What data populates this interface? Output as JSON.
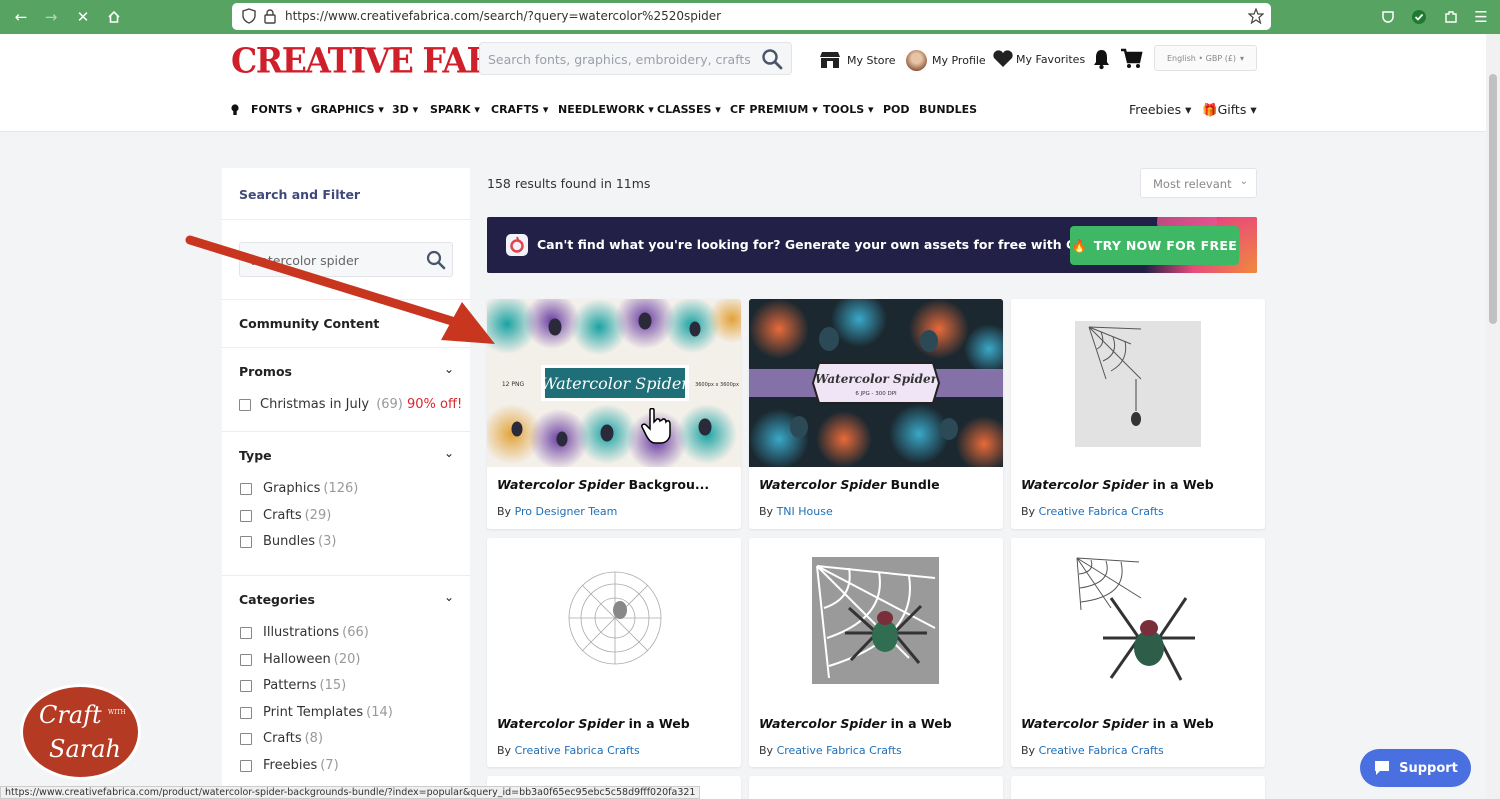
{
  "browser": {
    "url": "https://www.creativefabrica.com/search/?query=watercolor%2520spider",
    "status_url": "https://www.creativefabrica.com/product/watercolor-spider-backgrounds-bundle/?index=popular&query_id=bb3a0f65ec95ebc5c58d9fff020fa321"
  },
  "header": {
    "logo": "CREATIVE FABRICA",
    "search_placeholder": "Search fonts, graphics, embroidery, crafts",
    "my_store": "My Store",
    "my_profile": "My Profile",
    "my_favorites": "My Favorites",
    "language": "English • GBP (£)",
    "nav": [
      "FONTS",
      "GRAPHICS",
      "3D",
      "SPARK",
      "CRAFTS",
      "NEEDLEWORK",
      "CLASSES",
      "CF PREMIUM",
      "TOOLS",
      "POD",
      "BUNDLES"
    ],
    "freebies": "Freebies",
    "gifts": "Gifts"
  },
  "sidebar": {
    "title": "Search and Filter",
    "search_value": "watercolor spider",
    "community": "Community Content",
    "promos": {
      "title": "Promos",
      "item": "Christmas in July",
      "count": "(69)",
      "promo": "90% off!"
    },
    "type": {
      "title": "Type",
      "items": [
        {
          "label": "Graphics",
          "count": "(126)"
        },
        {
          "label": "Crafts",
          "count": "(29)"
        },
        {
          "label": "Bundles",
          "count": "(3)"
        }
      ]
    },
    "categories": {
      "title": "Categories",
      "items": [
        {
          "label": "Illustrations",
          "count": "(66)"
        },
        {
          "label": "Halloween",
          "count": "(20)"
        },
        {
          "label": "Patterns",
          "count": "(15)"
        },
        {
          "label": "Print Templates",
          "count": "(14)"
        },
        {
          "label": "Crafts",
          "count": "(8)"
        },
        {
          "label": "Freebies",
          "count": "(7)"
        }
      ]
    }
  },
  "main": {
    "results": "158 results found in 11ms",
    "sort": "Most relevant",
    "banner_text": "Can't find what you're looking for? Generate your own assets for free with CF SPARK.",
    "banner_button": "TRY NOW FOR FREE",
    "cards": [
      {
        "title_bold": "Watercolor Spider",
        "title_rest": " Backgrou...",
        "by": "By",
        "author": "Pro Designer Team",
        "img_label": "Watercolor Spider",
        "img_sub1": "12 PNG",
        "img_sub2": "3600px x 3600px"
      },
      {
        "title_bold": "Watercolor Spider",
        "title_rest": " Bundle",
        "by": "By",
        "author": "TNI House",
        "img_label": "Watercolor Spider",
        "img_sub1": "6 JPG - 300 DPI"
      },
      {
        "title_bold": "Watercolor Spider",
        "title_rest": " in a Web",
        "by": "By",
        "author": "Creative Fabrica Crafts"
      },
      {
        "title_bold": "Watercolor Spider",
        "title_rest": " in a Web",
        "by": "By",
        "author": "Creative Fabrica Crafts"
      },
      {
        "title_bold": "Watercolor Spider",
        "title_rest": " in a Web",
        "by": "By",
        "author": "Creative Fabrica Crafts"
      },
      {
        "title_bold": "Watercolor Spider",
        "title_rest": " in a Web",
        "by": "By",
        "author": "Creative Fabrica Crafts"
      }
    ]
  },
  "support": "Support",
  "watermark": {
    "line1": "Craft",
    "with": "WITH",
    "line2": "Sarah"
  }
}
